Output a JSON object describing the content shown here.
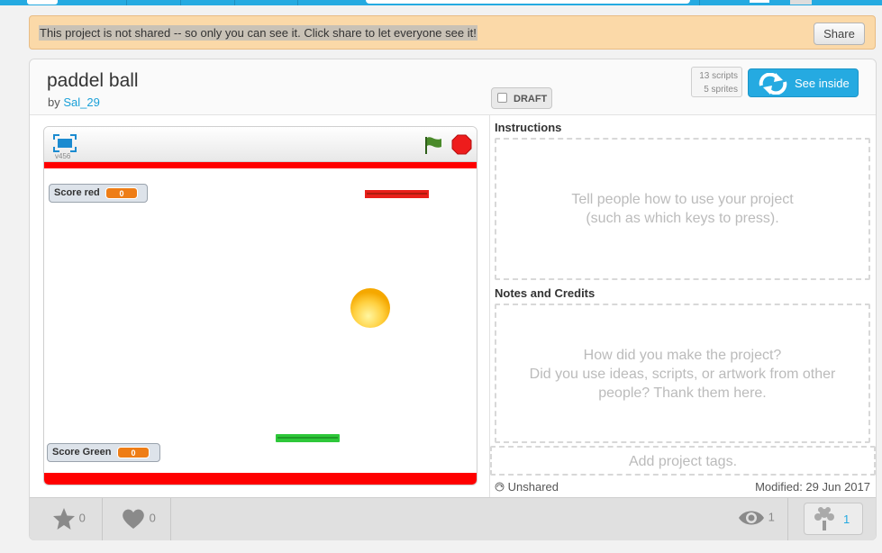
{
  "banner": {
    "message": "This project is not shared -- so only you can see it. Click share to let everyone see it!",
    "share_label": "Share"
  },
  "project": {
    "title": "paddel ball",
    "by_prefix": "by",
    "author": "Sal_29",
    "draft_label": "DRAFT",
    "scripts_count": "13 scripts",
    "sprites_count": "5 sprites",
    "see_inside_label": "See inside"
  },
  "player": {
    "version": "v456",
    "monitors": [
      {
        "label": "Score red",
        "value": "0"
      },
      {
        "label": "Score Green",
        "value": "0"
      }
    ],
    "colors": {
      "wall": "#ff0000",
      "red_paddle": "#e8201a",
      "green_paddle": "#2ec83a",
      "ball": "#ffd040",
      "flag": "#4a8a2a",
      "stop": "#ee1c1c"
    }
  },
  "instructions": {
    "heading": "Instructions",
    "placeholder_line1": "Tell people how to use your project",
    "placeholder_line2": "(such as which keys to press)."
  },
  "notes": {
    "heading": "Notes and Credits",
    "placeholder_line1": "How did you make the project?",
    "placeholder_line2": "Did you use ideas, scripts, or artwork from other",
    "placeholder_line3": "people? Thank them here."
  },
  "tags": {
    "placeholder": "Add project tags."
  },
  "status": {
    "unshared_label": "Unshared",
    "modified": "Modified: 29 Jun 2017"
  },
  "footer": {
    "favorites": "0",
    "loves": "0",
    "views": "1",
    "remixes": "1"
  },
  "accent": "#25aae1"
}
